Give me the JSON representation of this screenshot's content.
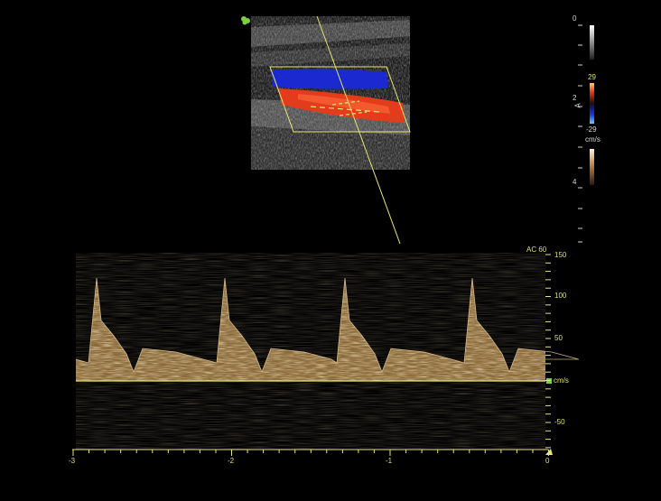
{
  "colors": {
    "background": "#000000",
    "marker_yellow": "#e8e870",
    "doppler_tan": "#c8a46a",
    "flow_red": "#e03a1a",
    "flow_blue": "#1428c8",
    "bmode_gray": "#9a9a9a"
  },
  "icons": {
    "probe_indicator": "probe-orientation-icon"
  },
  "grayscale_bar": {
    "top_label": "0"
  },
  "color_bar": {
    "top_label": "29",
    "mid_label": "2",
    "bottom_label": "-29",
    "axis_label": "A"
  },
  "power_bar": {
    "unit_label": "cm/s",
    "mid_label": "4"
  },
  "spectral": {
    "preset_label": "AC 60",
    "velocity_unit": "cm/s",
    "velocity_scale_labels": [
      "150",
      "100",
      "50",
      "-50"
    ],
    "time_axis_labels": [
      "-3",
      "-2",
      "-1",
      "0"
    ]
  }
}
